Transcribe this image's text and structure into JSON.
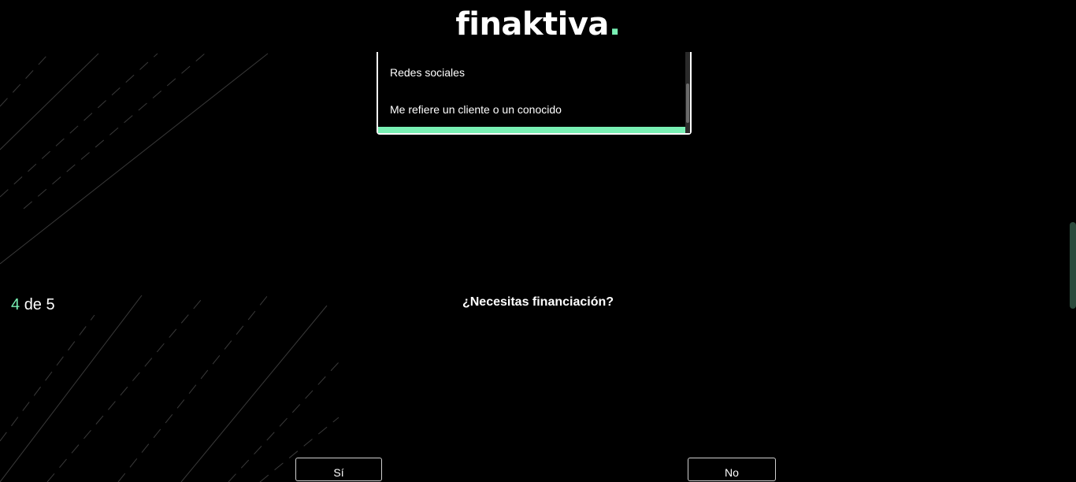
{
  "header": {
    "logo_text": "finaktiva",
    "logo_dot": ".",
    "accent_color": "#79f0b4"
  },
  "dropdown": {
    "options": [
      "Redes sociales",
      "Me refiere un cliente o un conocido"
    ]
  },
  "progress": {
    "current": "4",
    "separator": "de",
    "total": "5"
  },
  "question": {
    "text": "¿Necesitas financiación?"
  },
  "answers": {
    "yes_label": "Sí",
    "no_label": "No"
  }
}
